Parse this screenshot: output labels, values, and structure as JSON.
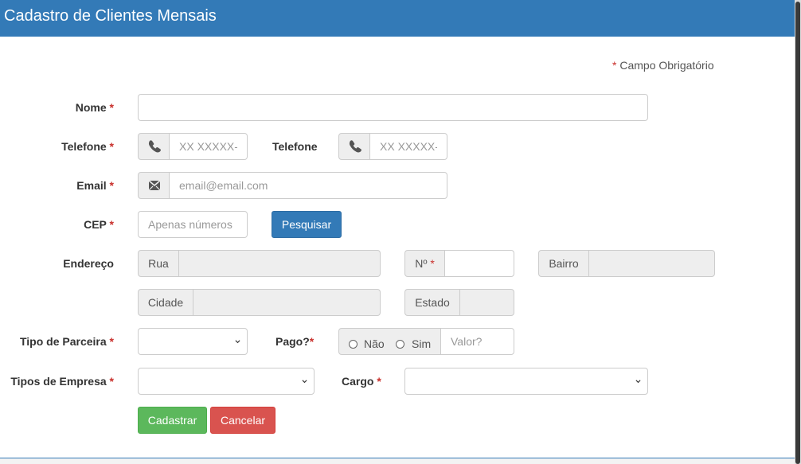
{
  "header": {
    "title": "Cadastro de Clientes Mensais"
  },
  "required_note": {
    "marker": "*",
    "text": "Campo Obrigatório"
  },
  "form": {
    "nome": {
      "label": "Nome",
      "marker": "*",
      "value": "",
      "placeholder": ""
    },
    "telefone1": {
      "label": "Telefone",
      "marker": "*",
      "placeholder": "XX XXXXX-XXXX",
      "icon": "phone-icon"
    },
    "telefone2": {
      "label": "Telefone",
      "placeholder": "XX XXXXX-XXXX",
      "icon": "phone-icon"
    },
    "email": {
      "label": "Email",
      "marker": "*",
      "placeholder": "email@email.com",
      "icon": "envelope-icon"
    },
    "cep": {
      "label": "CEP",
      "marker": "*",
      "placeholder": "Apenas números",
      "search_button": "Pesquisar"
    },
    "endereco": {
      "label": "Endereço",
      "rua": "Rua",
      "numero": "Nº",
      "numero_marker": "*",
      "bairro": "Bairro",
      "cidade": "Cidade",
      "estado": "Estado"
    },
    "tipo_parceira": {
      "label": "Tipo de Parceira",
      "marker": "*",
      "selected": ""
    },
    "pago": {
      "label": "Pago?",
      "marker": "*",
      "option_nao": "Não",
      "option_sim": "Sim",
      "valor_placeholder": "Valor?"
    },
    "tipos_empresa": {
      "label": "Tipos de Empresa",
      "marker": "*",
      "selected": ""
    },
    "cargo": {
      "label": "Cargo",
      "marker": "*",
      "selected": ""
    }
  },
  "actions": {
    "submit": "Cadastrar",
    "cancel": "Cancelar"
  },
  "colors": {
    "primary": "#337ab7",
    "success": "#5cb85c",
    "danger": "#d9534f",
    "required": "#c9302c"
  }
}
